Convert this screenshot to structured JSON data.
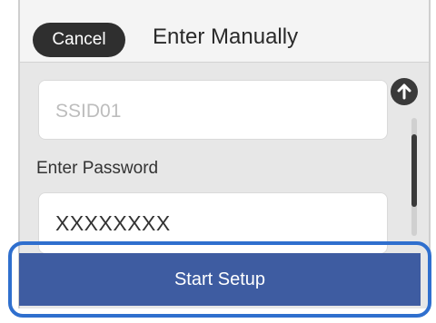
{
  "header": {
    "cancel_label": "Cancel",
    "title": "Enter Manually"
  },
  "form": {
    "ssid_value": "SSID01",
    "password_label": "Enter Password",
    "password_value": "XXXXXXXX"
  },
  "actions": {
    "start_label": "Start Setup"
  },
  "scrollbar": {
    "up_icon": "arrow-up-icon"
  },
  "colors": {
    "header_bg": "#f4f4f4",
    "screen_bg": "#e7e7e7",
    "cancel_bg": "#2f2f2f",
    "start_bg": "#3e5ca1",
    "highlight": "#2f6fce"
  }
}
